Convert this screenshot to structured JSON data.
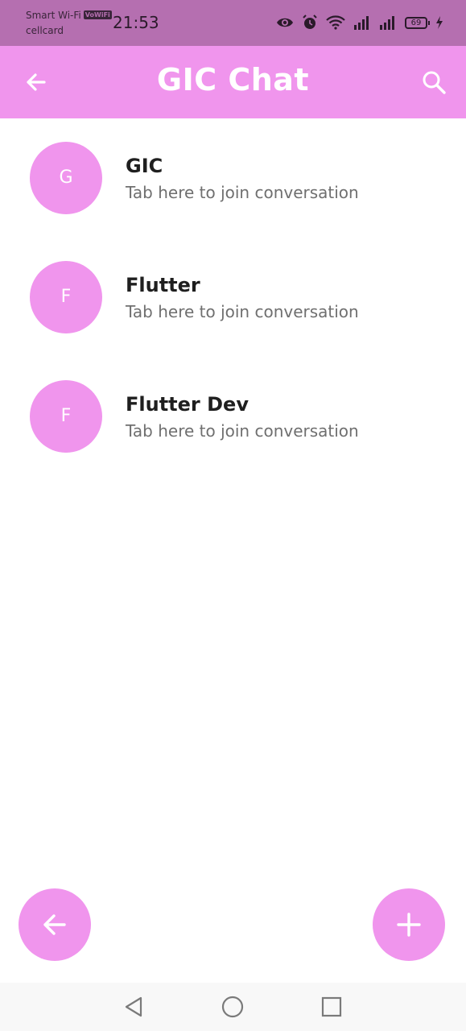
{
  "status_bar": {
    "carrier_line1": "Smart Wi-Fi",
    "vowifi_badge": "VoWiFi",
    "carrier_line2": "cellcard",
    "time": "21:53",
    "battery": "69",
    "icons": [
      "eye-icon",
      "alarm-icon",
      "wifi-icon",
      "signal-icon",
      "signal-icon",
      "battery-icon",
      "charging-icon"
    ]
  },
  "app_bar": {
    "title": "GIC Chat",
    "back_icon": "arrow-back-icon",
    "search_icon": "search-icon"
  },
  "conversations": [
    {
      "initial": "G",
      "title": "GIC",
      "subtitle": "Tab here to join conversation"
    },
    {
      "initial": "F",
      "title": "Flutter",
      "subtitle": "Tab here to join conversation"
    },
    {
      "initial": "F",
      "title": "Flutter Dev",
      "subtitle": "Tab here to join conversation"
    }
  ],
  "fabs": {
    "back_icon": "arrow-back-icon",
    "add_icon": "plus-icon"
  },
  "colors": {
    "accent": "#f095ed",
    "status_bar": "#b56fb0",
    "text_primary": "#1f1f1f",
    "text_secondary": "#6f6f6f"
  }
}
